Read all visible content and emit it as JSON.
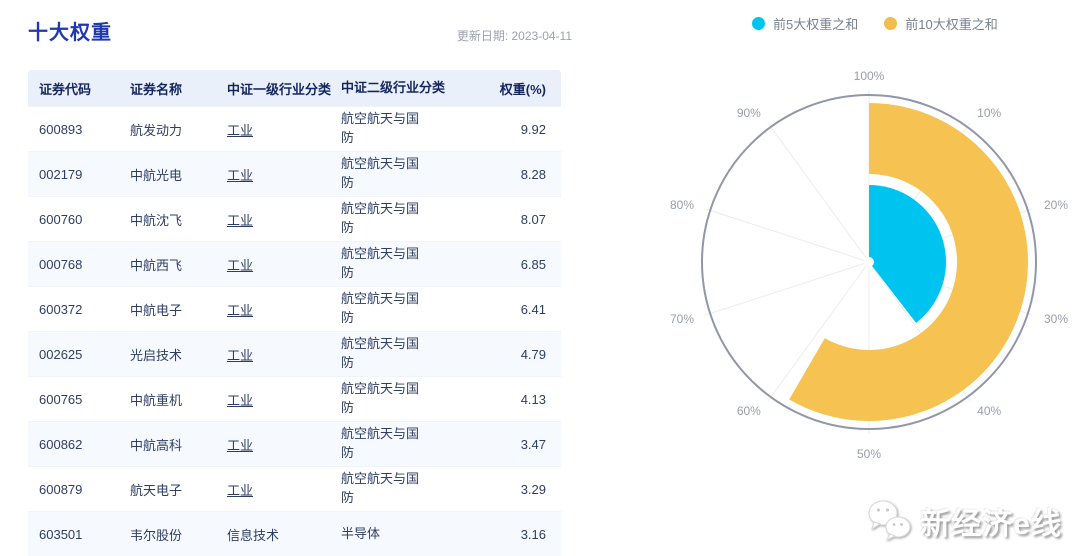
{
  "page": {
    "title": "十大权重",
    "update_date": "更新日期: 2023-04-11"
  },
  "table": {
    "headers": [
      "证券代码",
      "证券名称",
      "中证一级行业分类",
      "中证二级行业分类",
      "权重(%)"
    ],
    "rows": [
      {
        "code": "600893",
        "name": "航发动力",
        "industry1": "工业",
        "industry1_link": true,
        "industry2": "航空航天与国防",
        "weight": "9.92"
      },
      {
        "code": "002179",
        "name": "中航光电",
        "industry1": "工业",
        "industry1_link": true,
        "industry2": "航空航天与国防",
        "weight": "8.28"
      },
      {
        "code": "600760",
        "name": "中航沈飞",
        "industry1": "工业",
        "industry1_link": true,
        "industry2": "航空航天与国防",
        "weight": "8.07"
      },
      {
        "code": "000768",
        "name": "中航西飞",
        "industry1": "工业",
        "industry1_link": true,
        "industry2": "航空航天与国防",
        "weight": "6.85"
      },
      {
        "code": "600372",
        "name": "中航电子",
        "industry1": "工业",
        "industry1_link": true,
        "industry2": "航空航天与国防",
        "weight": "6.41"
      },
      {
        "code": "002625",
        "name": "光启技术",
        "industry1": "工业",
        "industry1_link": true,
        "industry2": "航空航天与国防",
        "weight": "4.79"
      },
      {
        "code": "600765",
        "name": "中航重机",
        "industry1": "工业",
        "industry1_link": true,
        "industry2": "航空航天与国防",
        "weight": "4.13"
      },
      {
        "code": "600862",
        "name": "中航高科",
        "industry1": "工业",
        "industry1_link": true,
        "industry2": "航空航天与国防",
        "weight": "3.47"
      },
      {
        "code": "600879",
        "name": "航天电子",
        "industry1": "工业",
        "industry1_link": true,
        "industry2": "航空航天与国防",
        "weight": "3.29"
      },
      {
        "code": "603501",
        "name": "韦尔股份",
        "industry1": "信息技术",
        "industry1_link": false,
        "industry2": "半导体",
        "weight": "3.16"
      }
    ]
  },
  "legend": [
    {
      "label": "前5大权重之和",
      "color": "#00c4f0"
    },
    {
      "label": "前10大权重之和",
      "color": "#f2bd4d"
    }
  ],
  "chart_data": {
    "type": "polar-ring",
    "title": "",
    "max": 100,
    "start_angle_deg": 0,
    "clockwise": true,
    "angle_ticks": [
      "100%",
      "10%",
      "20%",
      "30%",
      "40%",
      "50%",
      "60%",
      "70%",
      "80%",
      "90%"
    ],
    "legend_position": "top-right",
    "series": [
      {
        "name": "前5大权重之和",
        "value": 39.53,
        "color": "#00c4f0",
        "shape": "inner-sector"
      },
      {
        "name": "前10大权重之和",
        "value": 58.37,
        "color": "#f6c353",
        "shape": "outer-ring"
      }
    ],
    "axis_line_color": "#9197a9",
    "spoke_color": "#ececf2",
    "tick_label_color": "#979dab"
  },
  "watermark": {
    "text": "新经济e线",
    "icon": "wechat-icon"
  }
}
